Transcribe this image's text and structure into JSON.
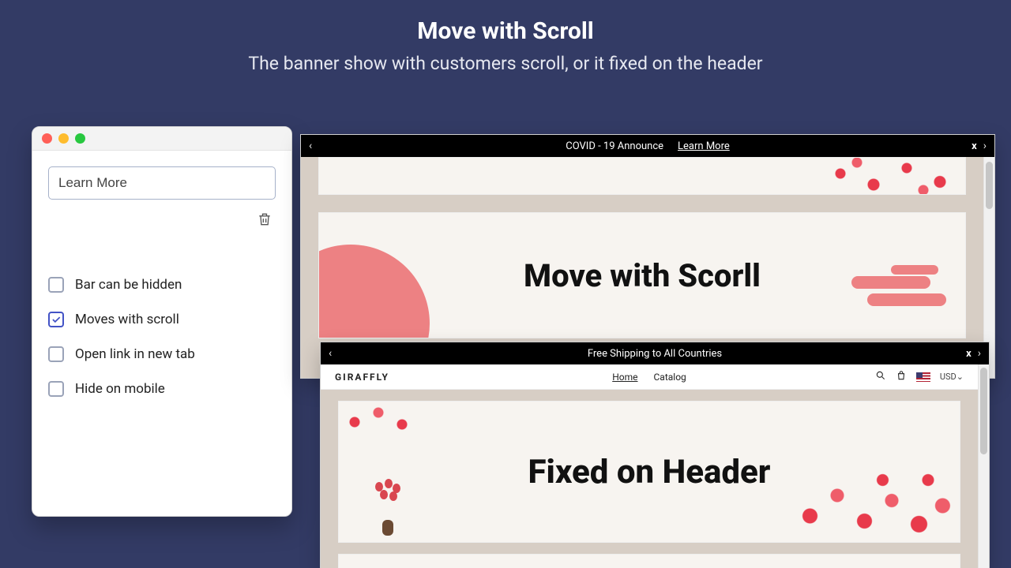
{
  "hero": {
    "title": "Move with Scroll",
    "subtitle": "The banner show with customers scroll, or it fixed on the header"
  },
  "panel": {
    "input_value": "Learn More",
    "options": {
      "bar_hidden": "Bar can be hidden",
      "moves_scroll": "Moves with scroll",
      "open_new_tab": "Open link in new tab",
      "hide_mobile": "Hide on mobile"
    },
    "checked": {
      "bar_hidden": false,
      "moves_scroll": true,
      "open_new_tab": false,
      "hide_mobile": false
    }
  },
  "preview_a": {
    "bar_text": "COVID - 19 Announce",
    "bar_link": "Learn More",
    "banner_title": "Move with Scorll"
  },
  "preview_b": {
    "bar_text": "Free Shipping to All Countries",
    "brand": "GIRAFFLY",
    "nav": {
      "home": "Home",
      "catalog": "Catalog"
    },
    "currency": "USD",
    "banner_title": "Fixed on Header"
  },
  "icons": {
    "close": "x",
    "chev_left": "‹",
    "chev_right": "›",
    "chev_down": "⌄"
  }
}
